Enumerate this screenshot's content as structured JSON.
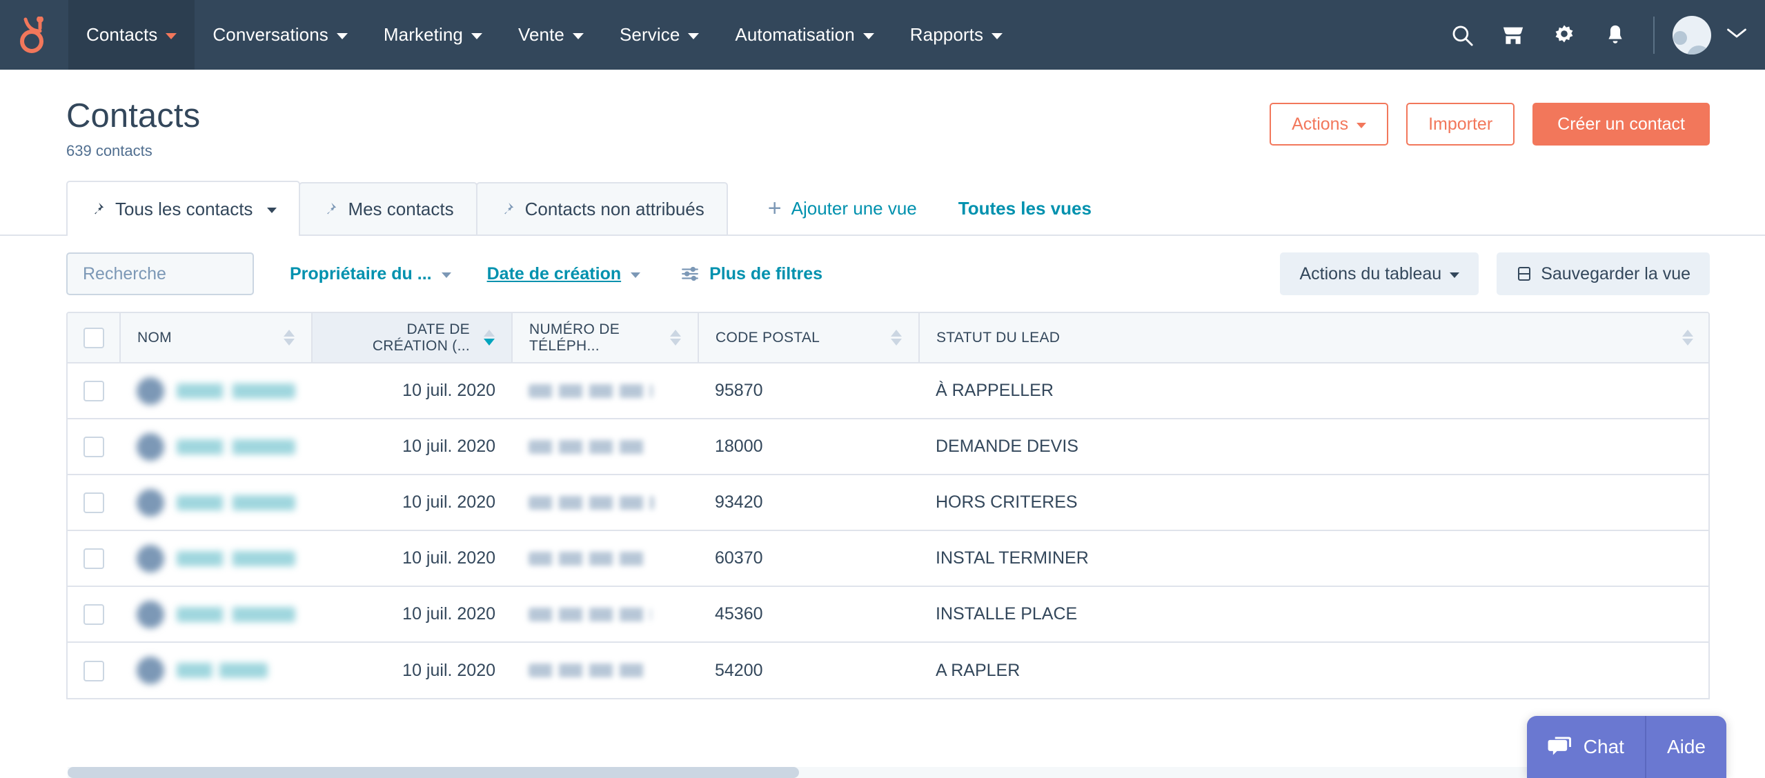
{
  "brand": {
    "accent_orange": "#f2775b",
    "nav_bg": "#33475b",
    "teal": "#0091ae",
    "chat_purple": "#6a78d1",
    "logo_name": "hubspot-sprocket-logo"
  },
  "topnav": {
    "items": [
      {
        "label": "Contacts",
        "active": true,
        "has_caret": true
      },
      {
        "label": "Conversations",
        "active": false,
        "has_caret": true
      },
      {
        "label": "Marketing",
        "active": false,
        "has_caret": true
      },
      {
        "label": "Vente",
        "active": false,
        "has_caret": true
      },
      {
        "label": "Service",
        "active": false,
        "has_caret": true
      },
      {
        "label": "Automatisation",
        "active": false,
        "has_caret": true
      },
      {
        "label": "Rapports",
        "active": false,
        "has_caret": true
      }
    ],
    "icons": [
      {
        "name": "search-icon"
      },
      {
        "name": "marketplace-icon"
      },
      {
        "name": "settings-gear-icon"
      },
      {
        "name": "notifications-bell-icon"
      }
    ],
    "avatar_name": "user-avatar",
    "avatar_chevron": "chevron-down-icon"
  },
  "header": {
    "title": "Contacts",
    "count": "639 contacts",
    "actions_label": "Actions",
    "import_label": "Importer",
    "create_label": "Créer un contact"
  },
  "tabs": [
    {
      "label": "Tous les contacts",
      "active": true,
      "pinned": true,
      "has_caret": true
    },
    {
      "label": "Mes contacts",
      "active": false,
      "pinned": true,
      "has_caret": false
    },
    {
      "label": "Contacts non attribués",
      "active": false,
      "pinned": true,
      "has_caret": false
    }
  ],
  "tab_links": {
    "add_view": "Ajouter une vue",
    "all_views": "Toutes les vues"
  },
  "filters": {
    "search_placeholder": "Recherche",
    "search_value": "",
    "owner_filter": "Propriétaire du ...",
    "date_filter": "Date de création",
    "more_filters": "Plus de filtres",
    "table_actions": "Actions du tableau",
    "save_view": "Sauvegarder la vue"
  },
  "table": {
    "columns": [
      {
        "label": "NOM",
        "sort": "none"
      },
      {
        "label": "DATE DE CRÉATION (...",
        "sort": "desc"
      },
      {
        "label": "NUMÉRO DE TÉLÉPH...",
        "sort": "none"
      },
      {
        "label": "CODE POSTAL",
        "sort": "none"
      },
      {
        "label": "STATUT DU LEAD",
        "sort": "none"
      }
    ],
    "rows": [
      {
        "name": "",
        "name_redacted": true,
        "date": "10 juil. 2020",
        "phone": "",
        "phone_redacted": true,
        "postal": "95870",
        "status": "À RAPPELLER"
      },
      {
        "name": "",
        "name_redacted": true,
        "date": "10 juil. 2020",
        "phone": "",
        "phone_redacted": true,
        "postal": "18000",
        "status": "DEMANDE DEVIS"
      },
      {
        "name": "",
        "name_redacted": true,
        "date": "10 juil. 2020",
        "phone": "",
        "phone_redacted": true,
        "postal": "93420",
        "status": "HORS CRITERES"
      },
      {
        "name": "",
        "name_redacted": true,
        "date": "10 juil. 2020",
        "phone": "",
        "phone_redacted": true,
        "postal": "60370",
        "status": "INSTAL TERMINER"
      },
      {
        "name": "",
        "name_redacted": true,
        "date": "10 juil. 2020",
        "phone": "",
        "phone_redacted": true,
        "postal": "45360",
        "status": "INSTALLE PLACE"
      },
      {
        "name": "",
        "name_redacted": true,
        "date": "10 juil. 2020",
        "phone": "",
        "phone_redacted": true,
        "postal": "54200",
        "status": "A RAPLER"
      }
    ]
  },
  "chat": {
    "chat_label": "Chat",
    "help_label": "Aide"
  }
}
